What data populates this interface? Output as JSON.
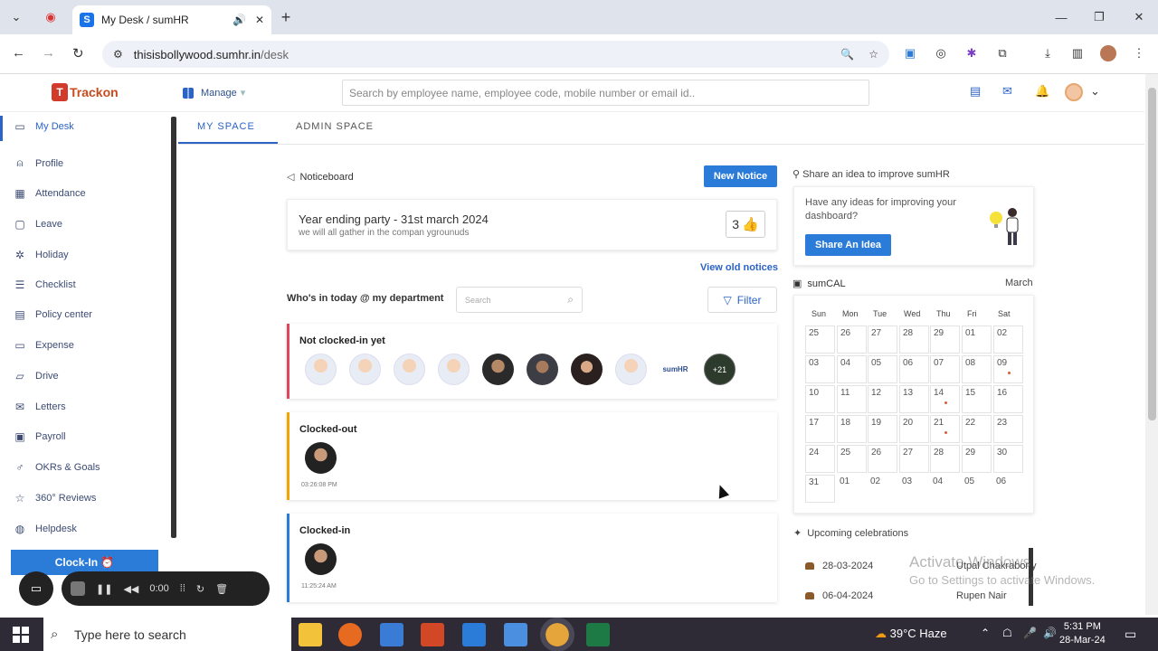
{
  "browser": {
    "tab_title": "My Desk / sumHR",
    "tab_favicon": "S",
    "url_host": "thisisbollywood.sumhr.in",
    "url_path": "/desk"
  },
  "header": {
    "logo_text": "Trackon",
    "manage_label": "Manage",
    "search_placeholder": "Search by employee name, employee code, mobile number or email id.."
  },
  "sidebar": {
    "items": [
      {
        "label": "My Desk",
        "icon": "monitor-icon"
      },
      {
        "label": "Profile",
        "icon": "user-icon"
      },
      {
        "label": "Attendance",
        "icon": "calendar-icon"
      },
      {
        "label": "Leave",
        "icon": "leave-icon"
      },
      {
        "label": "Holiday",
        "icon": "sun-icon"
      },
      {
        "label": "Checklist",
        "icon": "checklist-icon"
      },
      {
        "label": "Policy center",
        "icon": "policy-icon"
      },
      {
        "label": "Expense",
        "icon": "expense-icon"
      },
      {
        "label": "Drive",
        "icon": "folder-icon"
      },
      {
        "label": "Letters",
        "icon": "letter-icon"
      },
      {
        "label": "Payroll",
        "icon": "payroll-icon"
      },
      {
        "label": "OKRs & Goals",
        "icon": "goal-icon"
      },
      {
        "label": "360° Reviews",
        "icon": "star-icon"
      },
      {
        "label": "Helpdesk",
        "icon": "helpdesk-icon"
      }
    ],
    "clockin_label": "Clock-In ⏰"
  },
  "recorder": {
    "time": "0:00"
  },
  "tabs": [
    "MY SPACE",
    "ADMIN SPACE"
  ],
  "noticeboard": {
    "title": "Noticeboard",
    "new_notice": "New Notice",
    "notice_title": "Year ending party - 31st march 2024",
    "notice_body": "we will all gather in the compan ygrounuds",
    "likes": "3",
    "view_old": "View old notices"
  },
  "whos_in": {
    "title": "Who's in today @ my department",
    "search_placeholder": "Search",
    "filter": "Filter",
    "not_clocked": "Not clocked-in yet",
    "sumhr_label": "sumHR",
    "more_label": "+21",
    "clocked_out": "Clocked-out",
    "clocked_out_time": "03:26:08 PM",
    "clocked_in": "Clocked-in",
    "clocked_in_time": "11:25:24 AM"
  },
  "idea": {
    "title": "Share an idea to improve sumHR",
    "text": "Have any ideas for improving your dashboard?",
    "button": "Share An Idea"
  },
  "calendar": {
    "title": "sumCAL",
    "month": "March",
    "weekdays": [
      "Sun",
      "Mon",
      "Tue",
      "Wed",
      "Thu",
      "Fri",
      "Sat"
    ],
    "days": [
      "25",
      "26",
      "27",
      "28",
      "29",
      "01",
      "02",
      "03",
      "04",
      "05",
      "06",
      "07",
      "08",
      "09",
      "10",
      "11",
      "12",
      "13",
      "14",
      "15",
      "16",
      "17",
      "18",
      "19",
      "20",
      "21",
      "22",
      "23",
      "24",
      "25",
      "26",
      "27",
      "28",
      "29",
      "30",
      "31",
      "01",
      "02",
      "03",
      "04",
      "05",
      "06"
    ],
    "dot_days": [
      13,
      18,
      25
    ]
  },
  "celebrations": {
    "title": "Upcoming celebrations",
    "rows": [
      {
        "date": "28-03-2024",
        "name": "Utpal Chakraborty"
      },
      {
        "date": "06-04-2024",
        "name": "Rupen Nair"
      }
    ]
  },
  "watermark": {
    "line1": "Activate Windows",
    "line2": "Go to Settings to activate Windows."
  },
  "taskbar": {
    "search_placeholder": "Type here to search",
    "weather": "39°C  Haze",
    "time": "5:31 PM",
    "date": "28-Mar-24"
  }
}
